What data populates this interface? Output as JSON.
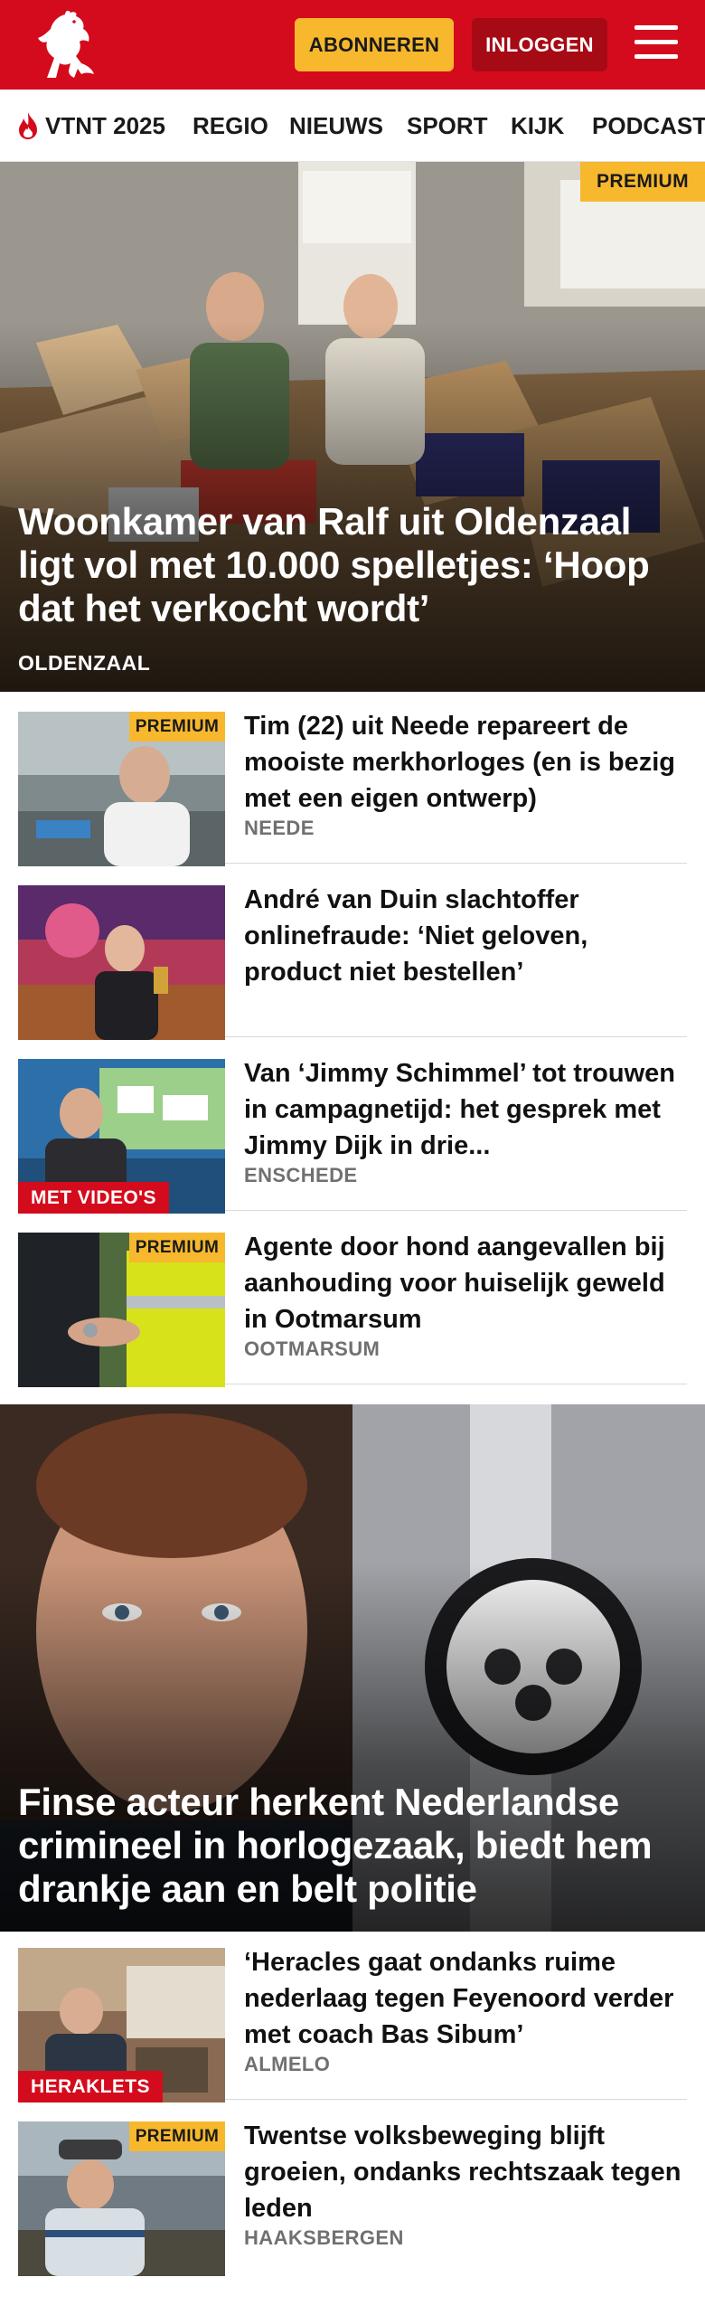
{
  "header": {
    "subscribe_label": "ABONNEREN",
    "login_label": "INLOGGEN",
    "brand_color": "#d40b1c",
    "accent_color": "#f7b82e"
  },
  "nav": {
    "items": [
      {
        "label": "VTNT 2025",
        "icon": "flame-icon"
      },
      {
        "label": "REGIO"
      },
      {
        "label": "NIEUWS"
      },
      {
        "label": "SPORT"
      },
      {
        "label": "KIJK"
      },
      {
        "label": "PODCAST"
      }
    ]
  },
  "hero": {
    "badge": "PREMIUM",
    "title": "Woonkamer van Ralf uit Oldenzaal ligt vol met 10.000 spelletjes: ‘Hoop dat het verkocht wordt’",
    "kicker": "OLDENZAAL"
  },
  "articles": [
    {
      "title": "Tim (22) uit Neede repareert de mooiste merkhorloges (en is bezig met een eigen ontwerp)",
      "kicker": "NEEDE",
      "badge": "PREMIUM"
    },
    {
      "title": "André van Duin slachtoffer onlinefraude: ‘Niet geloven, product niet bestellen’",
      "kicker": ""
    },
    {
      "title": "Van ‘Jimmy Schimmel’ tot trouwen in campagnetijd: het gesprek met Jimmy Dijk in drie...",
      "kicker": "ENSCHEDE",
      "video_badge": "MET VIDEO'S"
    },
    {
      "title": "Agente door hond aangevallen bij aanhouding voor huiselijk geweld in Ootmarsum",
      "kicker": "OOTMARSUM",
      "badge": "PREMIUM"
    }
  ],
  "hero2": {
    "title": "Finse acteur herkent Nederlandse crimineel in horlogezaak, biedt hem drankje aan en belt politie"
  },
  "articles2": [
    {
      "title": "‘Heracles gaat ondanks ruime nederlaag tegen Feyenoord verder met coach Bas Sibum’",
      "kicker": "ALMELO",
      "video_badge": "HERAKLETS"
    },
    {
      "title": "Twentse volksbeweging blijft groeien, ondanks rechtszaak tegen leden",
      "kicker": "HAAKSBERGEN",
      "badge": "PREMIUM"
    }
  ]
}
